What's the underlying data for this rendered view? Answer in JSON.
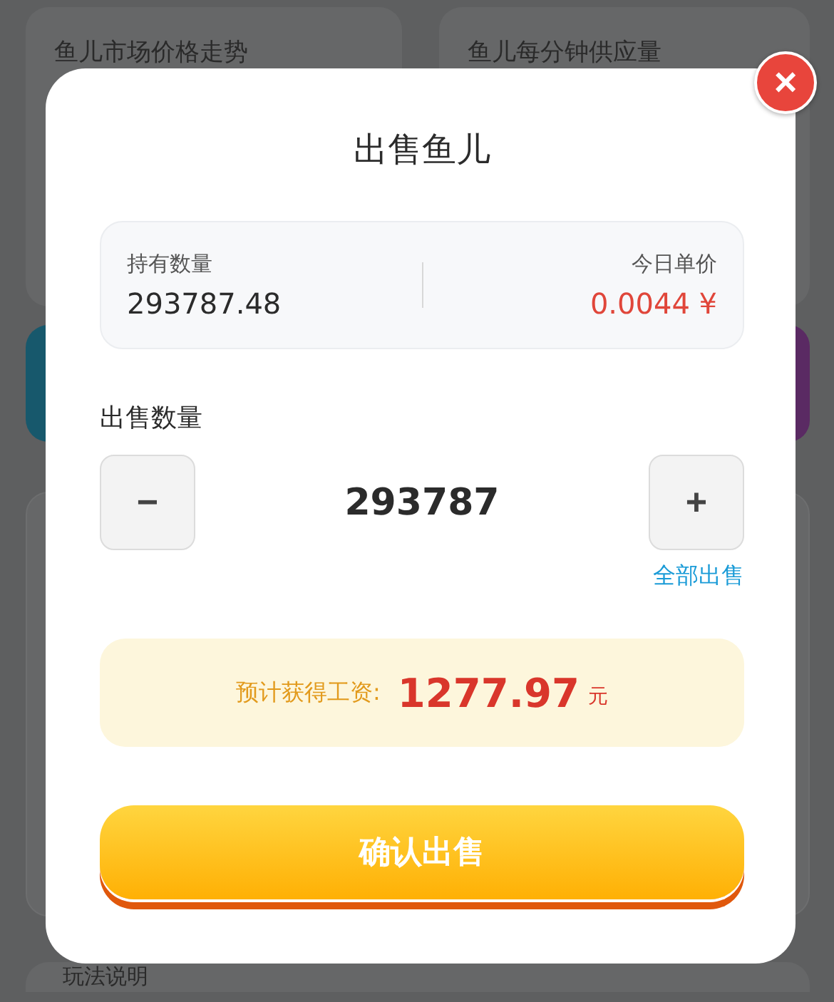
{
  "background": {
    "cards": [
      {
        "title": "鱼儿市场价格走势"
      },
      {
        "title": "鱼儿每分钟供应量"
      }
    ],
    "help_title": "玩法说明"
  },
  "dialog": {
    "title": "出售鱼儿",
    "close": "×",
    "holding": {
      "label": "持有数量",
      "value": "293787.48"
    },
    "price": {
      "label": "今日单价",
      "value": "0.0044 ¥"
    },
    "quantity_label": "出售数量",
    "minus": "−",
    "quantity": "293787",
    "plus": "+",
    "sell_all": "全部出售",
    "estimate": {
      "label": "预计获得工资:",
      "amount": "1277.97",
      "unit": "元"
    },
    "confirm": "确认出售"
  }
}
